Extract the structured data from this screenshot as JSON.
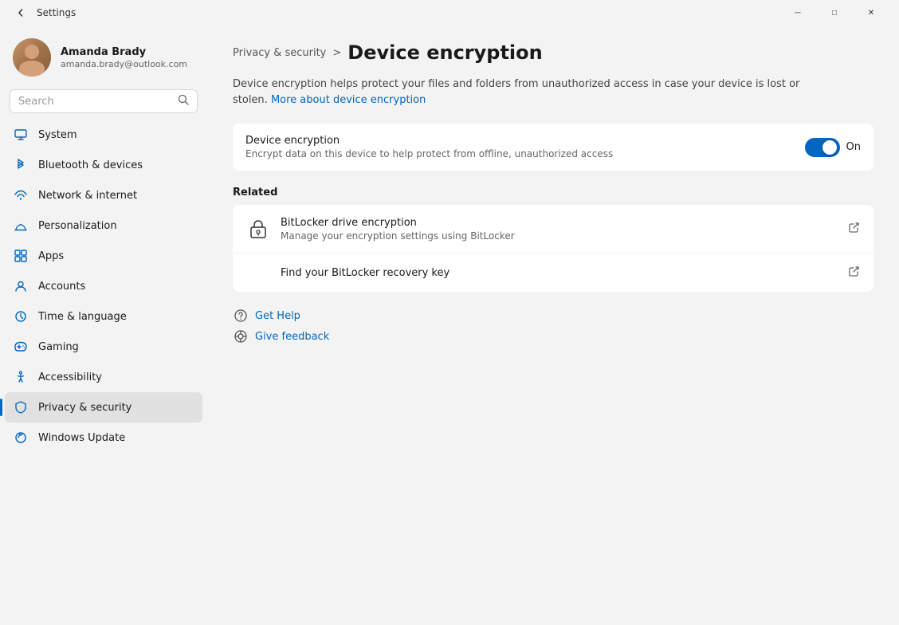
{
  "titlebar": {
    "title": "Settings",
    "back_label": "←",
    "minimize_label": "─",
    "maximize_label": "□",
    "close_label": "✕"
  },
  "sidebar": {
    "user": {
      "name": "Amanda Brady",
      "email": "amanda.brady@outlook.com"
    },
    "search": {
      "placeholder": "Search"
    },
    "nav_items": [
      {
        "id": "system",
        "label": "System",
        "icon": "system"
      },
      {
        "id": "bluetooth",
        "label": "Bluetooth & devices",
        "icon": "bluetooth"
      },
      {
        "id": "network",
        "label": "Network & internet",
        "icon": "network"
      },
      {
        "id": "personalization",
        "label": "Personalization",
        "icon": "personalization"
      },
      {
        "id": "apps",
        "label": "Apps",
        "icon": "apps"
      },
      {
        "id": "accounts",
        "label": "Accounts",
        "icon": "accounts"
      },
      {
        "id": "time",
        "label": "Time & language",
        "icon": "time"
      },
      {
        "id": "gaming",
        "label": "Gaming",
        "icon": "gaming"
      },
      {
        "id": "accessibility",
        "label": "Accessibility",
        "icon": "accessibility"
      },
      {
        "id": "privacy",
        "label": "Privacy & security",
        "icon": "privacy",
        "active": true
      },
      {
        "id": "update",
        "label": "Windows Update",
        "icon": "update"
      }
    ]
  },
  "breadcrumb": {
    "parent": "Privacy & security",
    "separator": ">",
    "current": "Device encryption"
  },
  "page_description": {
    "text": "Device encryption helps protect your files and folders from unauthorized access in case your device is lost or stolen. ",
    "link_text": "More about device encryption",
    "link_href": "#"
  },
  "device_encryption": {
    "title": "Device encryption",
    "description": "Encrypt data on this device to help protect from offline, unauthorized access",
    "toggle_state": "On",
    "toggle_on": true
  },
  "related": {
    "section_title": "Related",
    "items": [
      {
        "title": "BitLocker drive encryption",
        "description": "Manage your encryption settings using BitLocker",
        "external": true,
        "icon": "bitlocker"
      },
      {
        "title": "Find your BitLocker recovery key",
        "external": true
      }
    ]
  },
  "help": {
    "get_help_label": "Get Help",
    "give_feedback_label": "Give feedback"
  }
}
